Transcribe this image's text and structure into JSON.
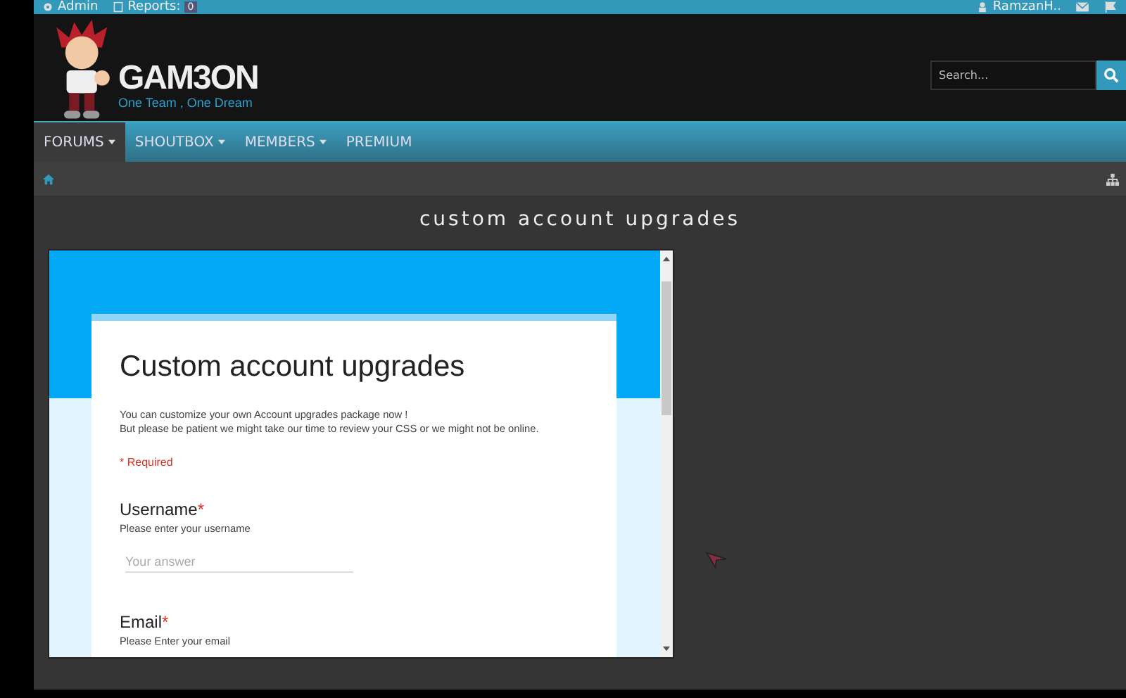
{
  "top_bar": {
    "items": [
      {
        "kind": "gear",
        "label": "Admin"
      },
      {
        "kind": "report",
        "label": "Reports:",
        "badge": "0"
      }
    ],
    "user": "RamzanH.."
  },
  "header": {
    "logo_title": "GAM3ON",
    "logo_tagline": "One Team , One Dream",
    "search": {
      "placeholder": "Search..."
    }
  },
  "nav": [
    {
      "label": "FORUMS",
      "dropdown": true,
      "selected": true
    },
    {
      "label": "SHOUTBOX",
      "dropdown": true,
      "selected": false
    },
    {
      "label": "MEMBERS",
      "dropdown": true,
      "selected": false
    },
    {
      "label": "PREMIUM",
      "dropdown": false,
      "selected": false
    }
  ],
  "page_title": "custom account upgrades",
  "form": {
    "title": "Custom account upgrades",
    "description": [
      "You can customize your own Account upgrades package now !",
      "But please be patient we might take our time to review your CSS or we might not be online."
    ],
    "required_note": "* Required",
    "questions": [
      {
        "label": "Username",
        "required_mark": "*",
        "help": "Please enter your username",
        "placeholder": "Your answer"
      },
      {
        "label": "Email",
        "required_mark": "*",
        "help": "Please Enter your email"
      }
    ]
  }
}
